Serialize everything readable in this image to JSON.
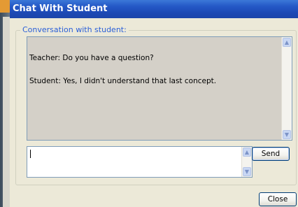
{
  "window": {
    "title": "Chat With Student"
  },
  "conversation": {
    "group_label": "Conversation with student:",
    "messages": [
      "Teacher: Do you have a question?",
      "Student: Yes, I didn't understand that last concept."
    ]
  },
  "compose": {
    "value": ""
  },
  "buttons": {
    "send": "Send",
    "close": "Close"
  },
  "icons": {
    "scroll_up": "chevron-up-icon",
    "scroll_down": "chevron-down-icon"
  },
  "colors": {
    "titlebar": "#245edb",
    "legend": "#2a5fd8",
    "window_bg": "#ece9d8"
  }
}
